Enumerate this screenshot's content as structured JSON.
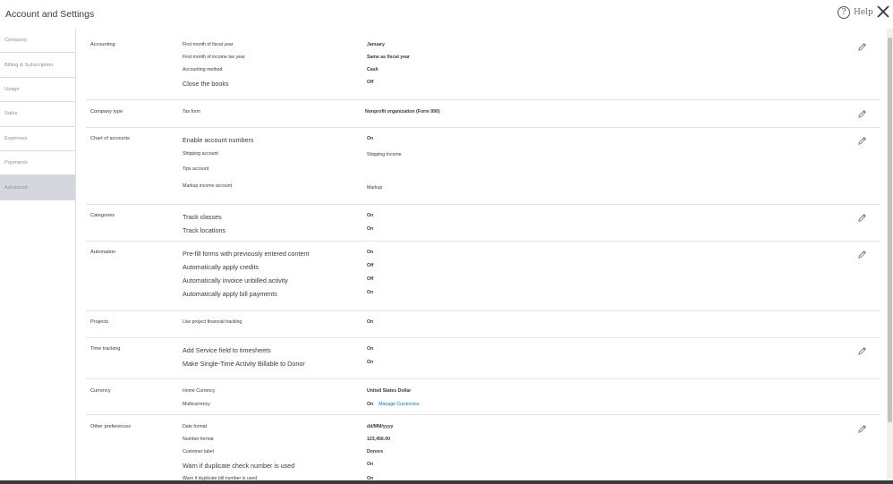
{
  "window": {
    "title": "Account and Settings",
    "help_label": "Help"
  },
  "sidebar": {
    "items": [
      {
        "label": "Company"
      },
      {
        "label": "Billing & Subscription"
      },
      {
        "label": "Usage"
      },
      {
        "label": "Sales"
      },
      {
        "label": "Expenses"
      },
      {
        "label": "Payments"
      },
      {
        "label": "Advanced",
        "active": true
      }
    ]
  },
  "sections": {
    "accounting": {
      "title": "Accounting",
      "rows": [
        {
          "label": "First month of fiscal year",
          "value": "January"
        },
        {
          "label": "First month of income tax year",
          "value": "Same as fiscal year"
        },
        {
          "label": "Accounting method",
          "value": "Cash"
        },
        {
          "label": "Close the books",
          "value": "Off"
        }
      ]
    },
    "company_type": {
      "title": "Company type",
      "rows": [
        {
          "label": "Tax form",
          "value": "Nonprofit organization (Form 990)"
        }
      ]
    },
    "chart_of_accounts": {
      "title": "Chart of accounts",
      "rows": [
        {
          "label": "Enable account numbers",
          "value": "On"
        },
        {
          "label": "Shipping account",
          "value": "Shipping Income"
        },
        {
          "label": "Tips account",
          "value": ""
        },
        {
          "label": "Markup income account",
          "value": "Markup"
        }
      ]
    },
    "categories": {
      "title": "Categories",
      "rows": [
        {
          "label": "Track classes",
          "value": "On"
        },
        {
          "label": "Track locations",
          "value": "On"
        }
      ]
    },
    "automation": {
      "title": "Automation",
      "rows": [
        {
          "label": "Pre-fill forms with previously entered content",
          "value": "On"
        },
        {
          "label": "Automatically apply credits",
          "value": "Off"
        },
        {
          "label": "Automatically invoice unbilled activity",
          "value": "Off"
        },
        {
          "label": "Automatically apply bill payments",
          "value": "On"
        }
      ]
    },
    "projects": {
      "title": "Projects",
      "rows": [
        {
          "label": "Use project financial tracking",
          "value": "On"
        }
      ]
    },
    "time_tracking": {
      "title": "Time tracking",
      "rows": [
        {
          "label": "Add Service field to timesheets",
          "value": "On"
        },
        {
          "label": "Make Single-Time Activity Billable to Donor",
          "value": "On"
        }
      ]
    },
    "currency": {
      "title": "Currency",
      "rows": [
        {
          "label": "Home Currency",
          "value": "United States Dollar"
        },
        {
          "label": "Multicurrency",
          "value": "On",
          "link": "Manage Currencies"
        }
      ]
    },
    "other_preferences": {
      "title": "Other preferences",
      "rows": [
        {
          "label": "Date format",
          "value": "dd/MM/yyyy"
        },
        {
          "label": "Number format",
          "value": "123,456.00"
        },
        {
          "label": "Customer label",
          "value": "Donors"
        },
        {
          "label": "Warn if duplicate check number is used",
          "value": "On"
        },
        {
          "label": "Warn if duplicate bill number is used",
          "value": "On"
        }
      ]
    }
  },
  "icons": {
    "help": "help-circle-icon",
    "close": "close-icon",
    "edit": "pencil-icon"
  },
  "colors": {
    "link": "#0077c5",
    "active_nav": "#d4d7dc",
    "text": "#393a3d"
  }
}
